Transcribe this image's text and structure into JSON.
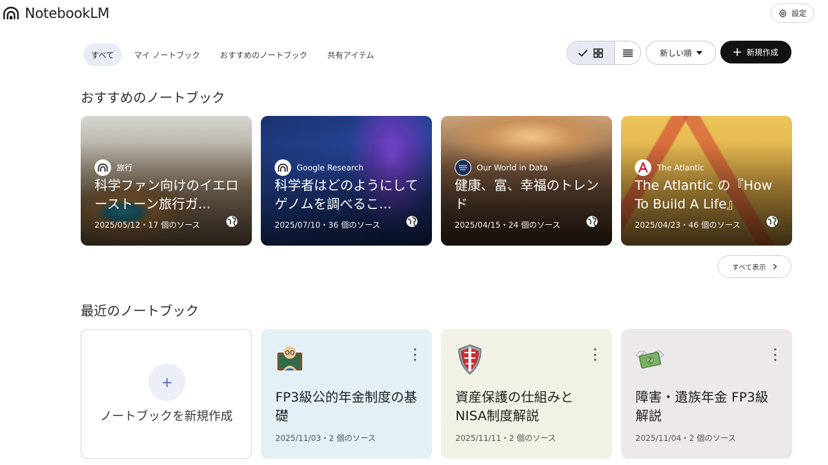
{
  "app": {
    "name": "NotebookLM",
    "settings_label": "設定"
  },
  "tabs": [
    {
      "label": "すべて",
      "active": true
    },
    {
      "label": "マイ ノートブック",
      "active": false
    },
    {
      "label": "おすすめのノートブック",
      "active": false
    },
    {
      "label": "共有アイテム",
      "active": false
    }
  ],
  "toolbar": {
    "sort_label": "新しい順",
    "new_label": "新規作成",
    "view_mode": "grid"
  },
  "featured": {
    "heading": "おすすめのノートブック",
    "show_all_label": "すべて表示",
    "cards": [
      {
        "source": "旅行",
        "source_logo": "notebooklm-logo",
        "title": "科学ファン向けのイエローストーン旅行ガ...",
        "meta": "2025/05/12・17 個のソース"
      },
      {
        "source": "Google Research",
        "source_logo": "notebooklm-logo",
        "title": "科学者はどのようにしてゲノムを調べるこ...",
        "meta": "2025/07/10・36 個のソース"
      },
      {
        "source": "Our World in Data",
        "source_logo": "our-world-in-data-logo",
        "title": "健康、富、幸福のトレンド",
        "meta": "2025/04/15・24 個のソース"
      },
      {
        "source": "The Atlantic",
        "source_logo": "the-atlantic-logo",
        "title": "The Atlantic の『How To Build A Life』",
        "meta": "2025/04/23・46 個のソース"
      }
    ]
  },
  "recent": {
    "heading": "最近のノートブック",
    "new_notebook_label": "ノートブックを新規作成",
    "cards": [
      {
        "emoji": "teacher-emoji",
        "title": "FP3級公的年金制度の基礎",
        "meta": "2025/11/03・2 個のソース",
        "color": "#e3f0f5"
      },
      {
        "emoji": "shield-emoji",
        "title": "資産保護の仕組みとNISA制度解説",
        "meta": "2025/11/11・2 個のソース",
        "color": "#f2f1e6"
      },
      {
        "emoji": "money-wings-emoji",
        "title": "障害・遺族年金 FP3級解説",
        "meta": "2025/11/04・2 個のソース",
        "color": "#ede8ec"
      }
    ]
  }
}
